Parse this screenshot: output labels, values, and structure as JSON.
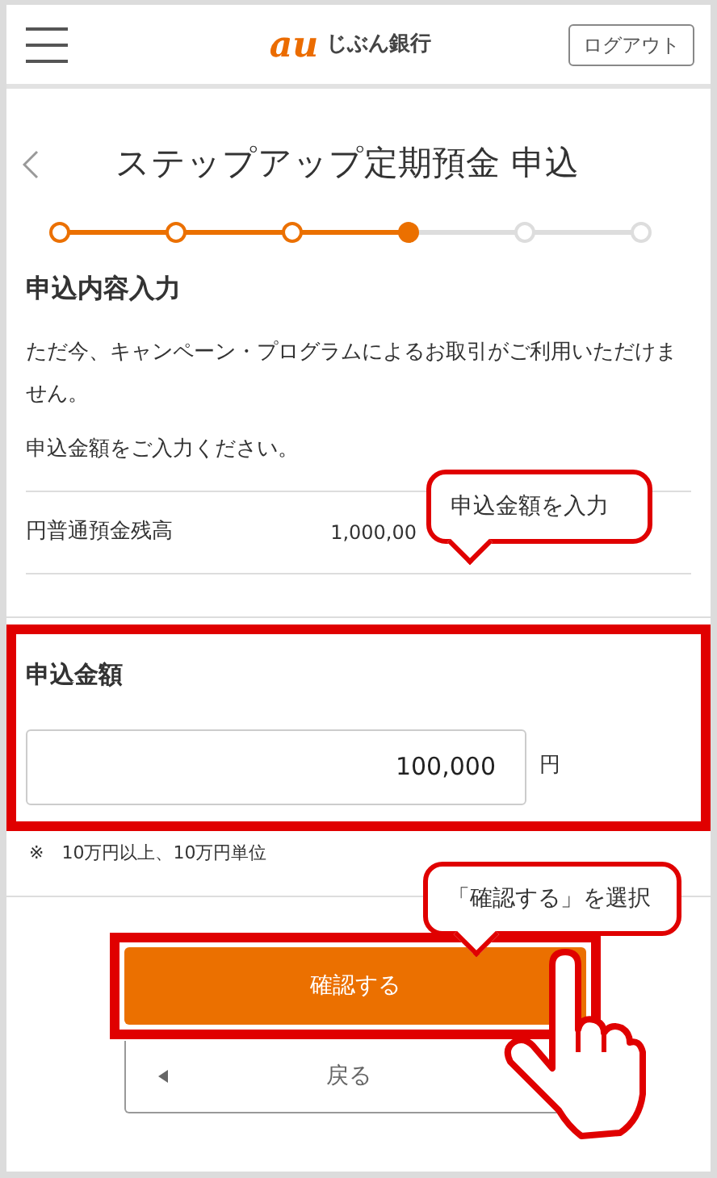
{
  "header": {
    "logo_mark": "au",
    "logo_text": "じぶん銀行",
    "logout_button": "ログアウト"
  },
  "page_title": "ステップアップ定期預金 申込",
  "steps": [
    {
      "done": true,
      "current": false
    },
    {
      "done": true,
      "current": false
    },
    {
      "done": true,
      "current": false
    },
    {
      "done": false,
      "current": true
    },
    {
      "done": false,
      "current": false
    },
    {
      "done": false,
      "current": false
    }
  ],
  "section_title": "申込内容入力",
  "notice": "ただ今、キャンペーン・プログラムによるお取引がご利用いただけません。",
  "instruction": "申込金額をご入力ください。",
  "balance": {
    "label": "円普通預金残高",
    "value": "1,000,00"
  },
  "amount": {
    "label": "申込金額",
    "value": "100,000",
    "unit": "円",
    "note": "※　10万円以上、10万円単位"
  },
  "buttons": {
    "confirm": "確認する",
    "back": "戻る"
  },
  "annotations": [
    {
      "text": "申込金額を入力"
    },
    {
      "text": "「確認する」を選択"
    }
  ]
}
